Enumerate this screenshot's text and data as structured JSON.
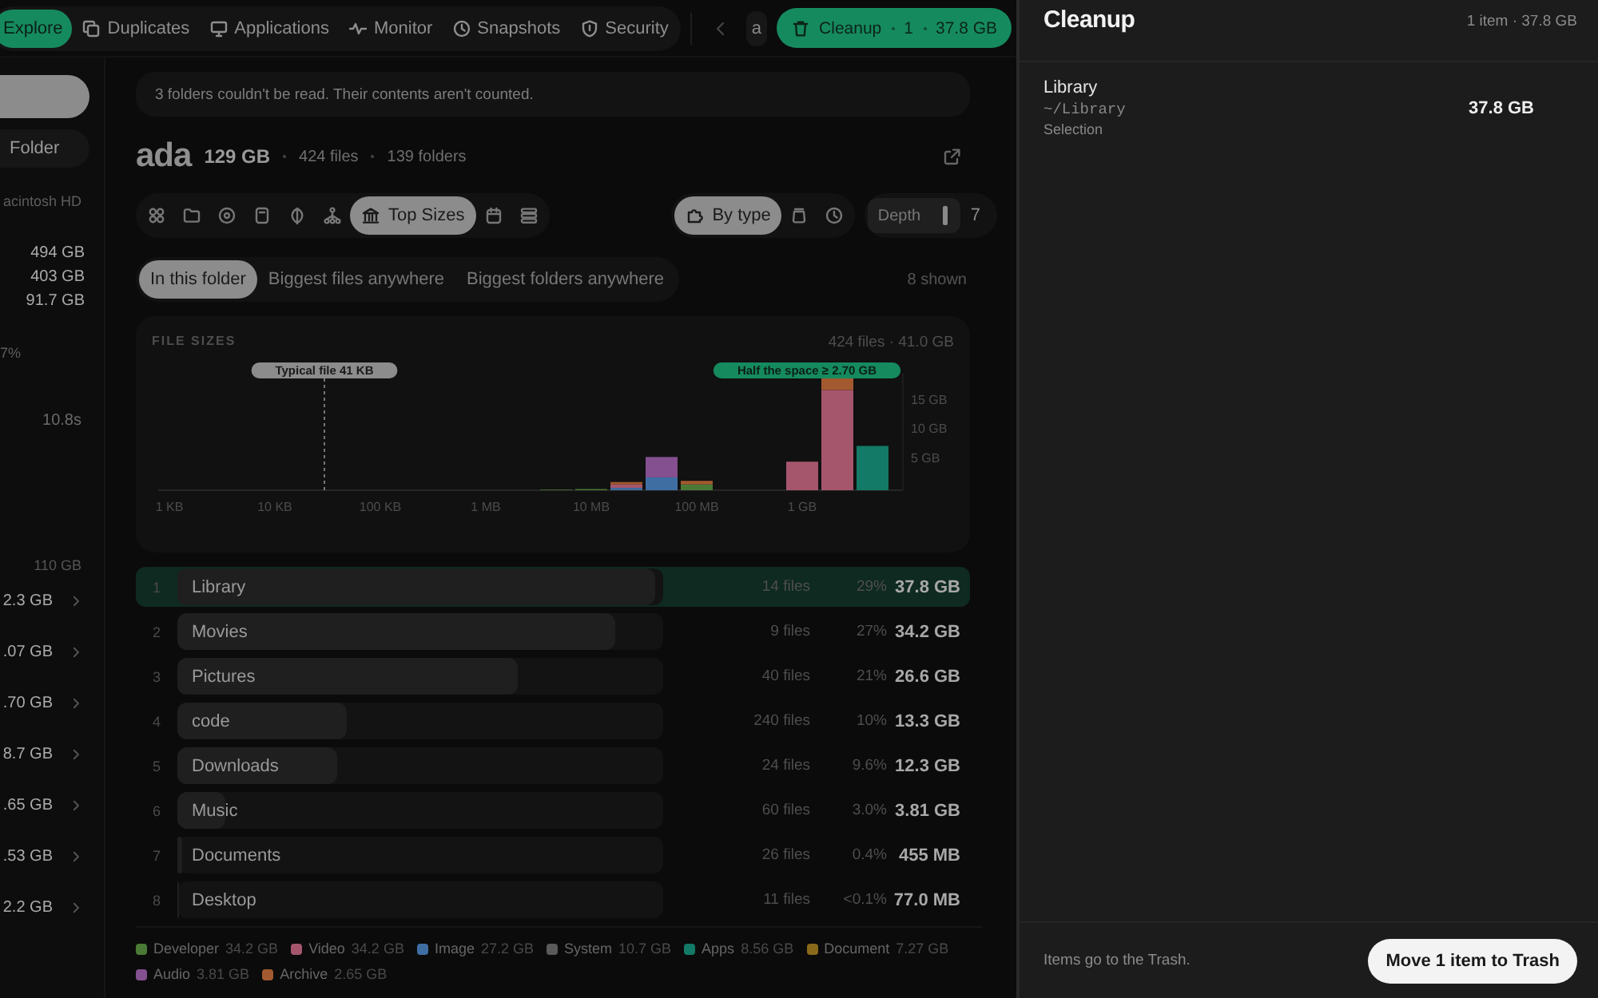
{
  "nav": {
    "tabs": [
      {
        "label": "Explore",
        "selected": true
      },
      {
        "label": "Duplicates",
        "selected": false
      },
      {
        "label": "Applications",
        "selected": false
      },
      {
        "label": "Monitor",
        "selected": false
      },
      {
        "label": "Snapshots",
        "selected": false
      },
      {
        "label": "Security",
        "selected": false
      }
    ],
    "chip": "a",
    "cleanup": {
      "label": "Cleanup",
      "count": "1",
      "size": "37.8 GB"
    }
  },
  "sidebar": {
    "button": "Folder",
    "label": "acintosh HD",
    "values": [
      "494 GB",
      "403 GB",
      "91.7 GB"
    ],
    "stats": [
      "7%",
      "10.8s"
    ],
    "total": "110 GB",
    "entries": [
      "2.3 GB",
      ".07 GB",
      ".70 GB",
      "8.7 GB",
      ".65 GB",
      ".53 GB",
      "2.2 GB"
    ]
  },
  "notice": "3 folders couldn't be read. Their contents aren't counted.",
  "folder": {
    "name": "ada",
    "size": "129 GB",
    "files": "424 files",
    "folders": "139 folders"
  },
  "views": [
    {
      "selected": false
    },
    {
      "selected": false
    },
    {
      "selected": false
    },
    {
      "selected": false
    },
    {
      "selected": false
    },
    {
      "selected": false
    },
    {
      "label": "Top Sizes",
      "selected": true
    },
    {
      "selected": false
    },
    {
      "selected": false
    }
  ],
  "groupings": [
    {
      "label": "By type",
      "selected": true
    },
    {
      "selected": false
    },
    {
      "selected": false
    }
  ],
  "depth": {
    "label": "Depth",
    "value": "7",
    "level": 0.85
  },
  "scopes": [
    {
      "label": "In this folder",
      "selected": true
    },
    {
      "label": "Biggest files anywhere",
      "selected": false
    },
    {
      "label": "Biggest folders anywhere",
      "selected": false
    }
  ],
  "shown": "8 shown",
  "chart": {
    "summary": "424 files · 41.0 GB",
    "chart_data": {
      "type": "bar",
      "title": "FILE SIZES",
      "stacked": true,
      "categories": [
        "1 KB",
        null,
        null,
        "10 KB",
        null,
        null,
        "100 KB",
        null,
        null,
        "1 MB",
        null,
        null,
        "10 MB",
        null,
        null,
        "100 MB",
        null,
        null,
        "1 GB",
        null,
        null
      ],
      "series": [
        {
          "color": "#4a7a35",
          "values": [
            0,
            0,
            0,
            0,
            0,
            0,
            0,
            0,
            0,
            0,
            0,
            0.1,
            0.2,
            0,
            0,
            1.0,
            0,
            0,
            0,
            0,
            0
          ]
        },
        {
          "color": "#3f6ea3",
          "values": [
            0,
            0,
            0,
            0,
            0,
            0,
            0,
            0,
            0,
            0,
            0,
            0,
            0,
            0.4,
            2.2,
            0,
            0,
            0,
            0,
            0,
            0
          ]
        },
        {
          "color": "#84508f",
          "values": [
            0,
            0,
            0,
            0,
            0,
            0,
            0,
            0,
            0,
            0,
            0,
            0,
            0,
            0,
            3.5,
            0,
            0,
            0,
            0,
            0,
            0
          ]
        },
        {
          "color": "#a5566d",
          "values": [
            0,
            0,
            0,
            0,
            0,
            0,
            0,
            0,
            0,
            0,
            0,
            0,
            0,
            0.6,
            0,
            0,
            0,
            0,
            4.9,
            17.2,
            0
          ]
        },
        {
          "color": "#a35a30",
          "values": [
            0,
            0,
            0,
            0,
            0,
            0,
            0,
            0,
            0,
            0,
            0,
            0,
            0,
            0.4,
            0,
            0.6,
            0,
            0,
            0,
            2.0,
            0
          ]
        },
        {
          "color": "#127a66",
          "values": [
            0,
            0,
            0,
            0,
            0,
            0,
            0,
            0,
            0,
            0,
            0,
            0,
            0,
            0,
            0,
            0,
            0,
            0,
            0,
            0,
            7.6
          ]
        }
      ],
      "yticks": [
        {
          "value": 5,
          "label": "5 GB"
        },
        {
          "value": 10,
          "label": "10 GB"
        },
        {
          "value": 15,
          "label": "15 GB"
        }
      ],
      "ylim": [
        0,
        20
      ],
      "annotations": [
        "Typical file 41 KB",
        "Half the space ≥ 2.70 GB"
      ]
    }
  },
  "rows": [
    {
      "rank": "1",
      "name": "Library",
      "level": 0.985,
      "files": "14 files",
      "share": "29%",
      "size": "37.8 GB",
      "selected": true
    },
    {
      "rank": "2",
      "name": "Movies",
      "level": 0.9,
      "files": "9 files",
      "share": "27%",
      "size": "34.2 GB",
      "selected": false
    },
    {
      "rank": "3",
      "name": "Pictures",
      "level": 0.7,
      "files": "40 files",
      "share": "21%",
      "size": "26.6 GB",
      "selected": false
    },
    {
      "rank": "4",
      "name": "code",
      "level": 0.35,
      "files": "240 files",
      "share": "10%",
      "size": "13.3 GB",
      "selected": false
    },
    {
      "rank": "5",
      "name": "Downloads",
      "level": 0.33,
      "files": "24 files",
      "share": "9.6%",
      "size": "12.3 GB",
      "selected": false
    },
    {
      "rank": "6",
      "name": "Music",
      "level": 0.1,
      "files": "60 files",
      "share": "3.0%",
      "size": "3.81 GB",
      "selected": false
    },
    {
      "rank": "7",
      "name": "Documents",
      "level": 0.01,
      "files": "26 files",
      "share": "0.4%",
      "size": "455 MB",
      "selected": false
    },
    {
      "rank": "8",
      "name": "Desktop",
      "level": 0.003,
      "files": "11 files",
      "share": "<0.1%",
      "size": "77.0 MB",
      "selected": false
    }
  ],
  "legend": [
    {
      "name": "Developer",
      "size": "34.2 GB",
      "color": "#4a7a35"
    },
    {
      "name": "Video",
      "size": "34.2 GB",
      "color": "#a5566d"
    },
    {
      "name": "Image",
      "size": "27.2 GB",
      "color": "#3f6ea3"
    },
    {
      "name": "System",
      "size": "10.7 GB",
      "color": "#5a5a5a"
    },
    {
      "name": "Apps",
      "size": "8.56 GB",
      "color": "#127a66"
    },
    {
      "name": "Document",
      "size": "7.27 GB",
      "color": "#8a6a1a"
    },
    {
      "name": "Audio",
      "size": "3.81 GB",
      "color": "#84508f"
    },
    {
      "name": "Archive",
      "size": "2.65 GB",
      "color": "#a35a30"
    }
  ],
  "cleanup": {
    "title": "Cleanup",
    "summary": "1 item · 37.8 GB",
    "items": [
      {
        "name": "Library",
        "path": "~/Library",
        "source": "Selection",
        "size": "37.8 GB"
      }
    ],
    "note": "Items go to the Trash.",
    "button": "Move 1 item to Trash"
  }
}
